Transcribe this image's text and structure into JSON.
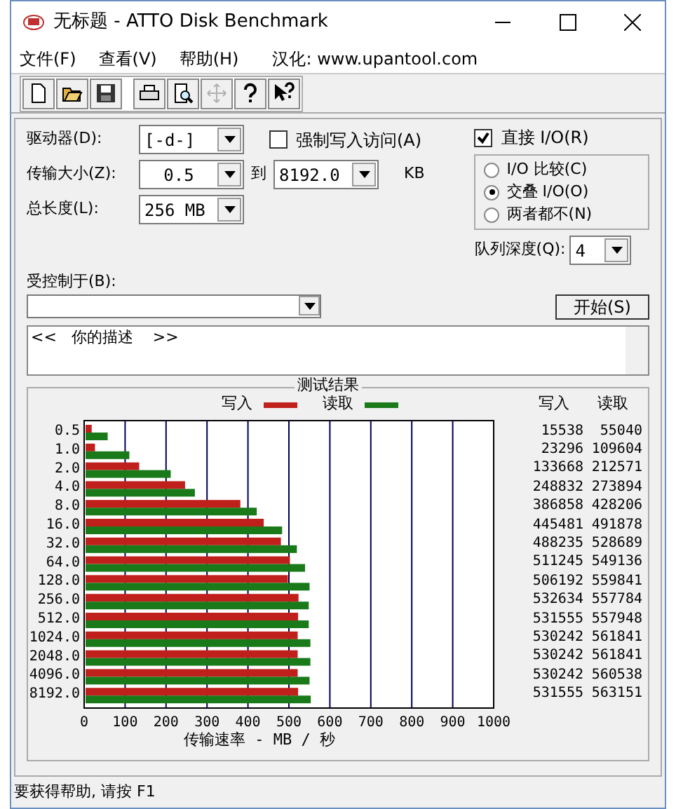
{
  "window": {
    "title": "无标题 - ATTO Disk Benchmark"
  },
  "menu": [
    "文件(F)",
    "查看(V)",
    "帮助(H)",
    "汉化: www.upantool.com"
  ],
  "toolbar": [
    {
      "kind": "new",
      "disabled": false
    },
    {
      "kind": "open",
      "disabled": false
    },
    {
      "kind": "save",
      "disabled": false
    },
    {
      "kind": "print",
      "disabled": false
    },
    {
      "kind": "preview",
      "disabled": false
    },
    {
      "kind": "move",
      "disabled": true
    },
    {
      "kind": "help",
      "disabled": false
    },
    {
      "kind": "context_help",
      "disabled": false
    }
  ],
  "drive": {
    "label": "驱动器(D):",
    "value": "[-d-]"
  },
  "force_write": {
    "label": "强制写入访问(A)",
    "checked": false
  },
  "direct_io": {
    "label": "直接 I/O(R)",
    "checked": true
  },
  "transfer_size": {
    "label": "传输大小(Z):",
    "from": "0.5",
    "to_label": "到",
    "to": "8192.0",
    "unit": "KB"
  },
  "total_length": {
    "label": "总长度(L):",
    "value": "256 MB"
  },
  "io_mode": [
    {
      "label": "I/O 比较(C)",
      "selected": false
    },
    {
      "label": "交叠 I/O(O)",
      "selected": true
    },
    {
      "label": "两者都不(N)",
      "selected": false
    }
  ],
  "queue_depth": {
    "label": "队列深度(Q):",
    "value": "4"
  },
  "controlled_by": {
    "label": "受控制于(B):"
  },
  "start_button": "开始(S)",
  "description": "<<   你的描述    >>",
  "results": {
    "title": "测试结果",
    "table": {
      "columns": [
        "写入",
        "读取"
      ],
      "rows": [
        [
          "15538",
          "55040"
        ],
        [
          "23296",
          "109604"
        ],
        [
          "133668",
          "212571"
        ],
        [
          "248832",
          "273894"
        ],
        [
          "386858",
          "428206"
        ],
        [
          "445481",
          "491878"
        ],
        [
          "488235",
          "528689"
        ],
        [
          "511245",
          "549136"
        ],
        [
          "506192",
          "559841"
        ],
        [
          "532634",
          "557784"
        ],
        [
          "531555",
          "557948"
        ],
        [
          "530242",
          "561841"
        ],
        [
          "530242",
          "561841"
        ],
        [
          "530242",
          "560538"
        ],
        [
          "531555",
          "563151"
        ]
      ]
    },
    "chart_data": {
      "type": "bar",
      "orientation": "horizontal",
      "xlabel": "传输速率 - MB / 秒",
      "categories": [
        "0.5",
        "1.0",
        "2.0",
        "4.0",
        "8.0",
        "16.0",
        "32.0",
        "64.0",
        "128.0",
        "256.0",
        "512.0",
        "1024.0",
        "2048.0",
        "4096.0",
        "8192.0"
      ],
      "series": [
        {
          "name": "写入",
          "color": "#c0201c",
          "values": [
            15,
            23,
            131,
            243,
            378,
            435,
            477,
            499,
            494,
            520,
            519,
            518,
            518,
            518,
            519
          ]
        },
        {
          "name": "读取",
          "color": "#1a7a1a",
          "values": [
            54,
            107,
            208,
            267,
            418,
            480,
            516,
            536,
            547,
            545,
            545,
            549,
            549,
            547,
            550
          ]
        }
      ],
      "xlim": [
        0,
        1000
      ],
      "grid": true,
      "xticks": [
        0,
        100,
        200,
        300,
        400,
        500,
        600,
        700,
        800,
        900,
        1000
      ]
    }
  },
  "status_bar": "要获得帮助, 请按 F1"
}
